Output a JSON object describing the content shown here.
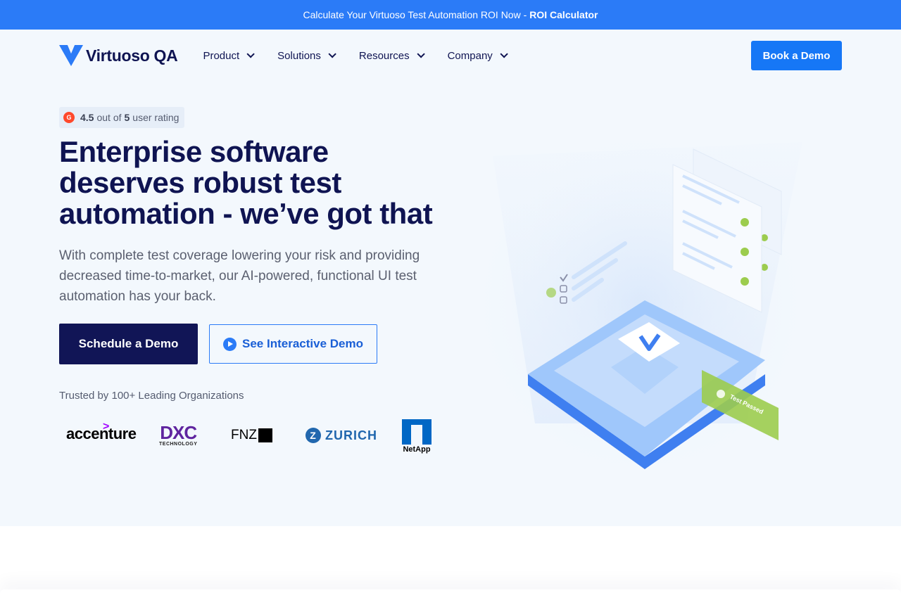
{
  "announcement": {
    "text": "Calculate Your Virtuoso Test Automation ROI Now -",
    "link_label": "ROI Calculator"
  },
  "brand": {
    "name": "Virtuoso QA",
    "accent": "#2b7bf7",
    "navy": "#111556"
  },
  "nav": {
    "items": [
      {
        "label": "Product"
      },
      {
        "label": "Solutions"
      },
      {
        "label": "Resources"
      },
      {
        "label": "Company"
      }
    ],
    "cta_label": "Book a Demo"
  },
  "rating": {
    "badge_icon": "g2-icon",
    "score": "4.5",
    "out_of": "out of",
    "max": "5",
    "suffix": "user rating"
  },
  "hero": {
    "headline": "Enterprise software deserves robust test automation - we’ve got that",
    "subtext": "With complete test coverage lowering your risk and providing decreased time-to-market, our AI-powered, functional UI test automation has your back.",
    "primary_cta": "Schedule a Demo",
    "secondary_cta": "See Interactive Demo"
  },
  "trusted": {
    "label": "Trusted by 100+ Leading Organizations",
    "logos": {
      "accenture": "accenture",
      "dxc": "DXC",
      "dxc_sub": "TECHNOLOGY",
      "fnz": "FNZ",
      "zurich": "ZURICH",
      "netapp": "NetApp"
    }
  },
  "illustration": {
    "badge_text": "Test Passed"
  }
}
